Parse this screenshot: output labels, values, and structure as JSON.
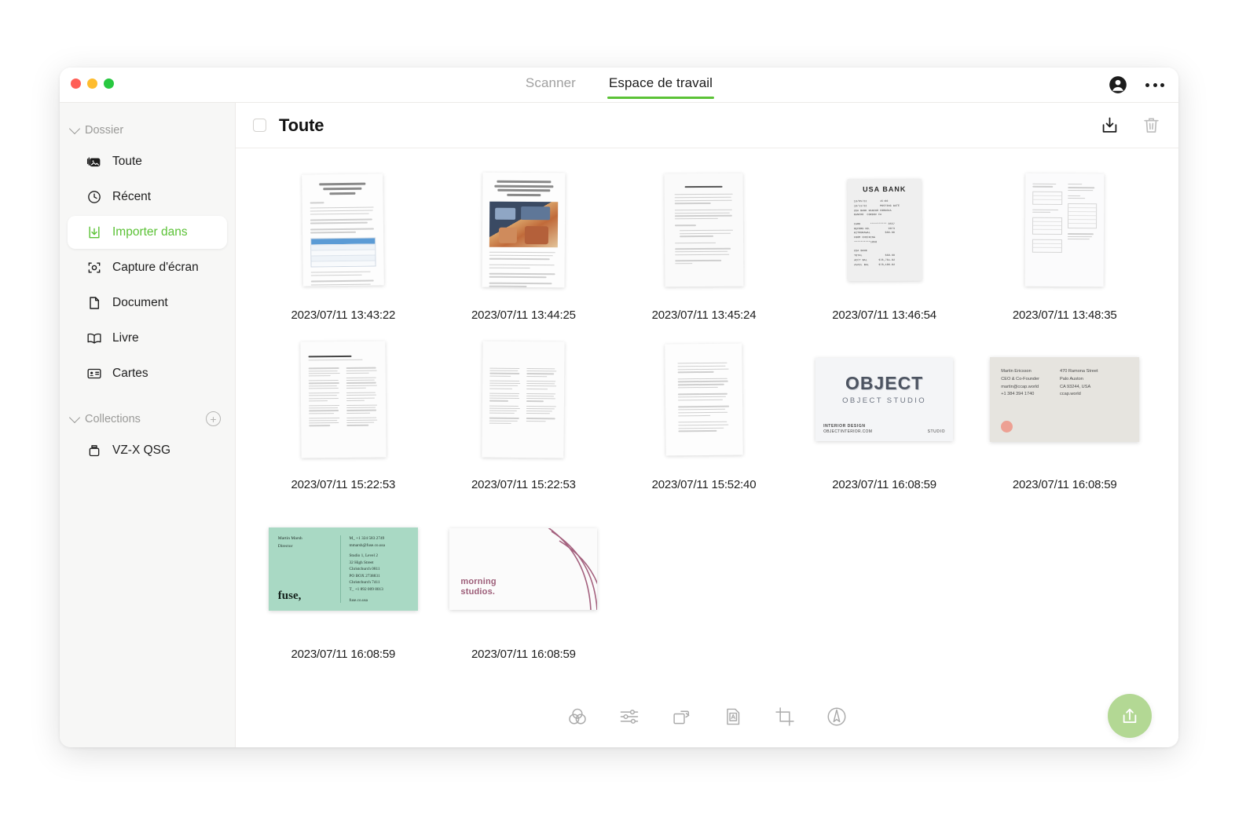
{
  "window": {
    "traffic_lights": [
      "close",
      "minimize",
      "zoom"
    ],
    "accent_color": "#5bc236",
    "fab_color": "#b3d894"
  },
  "header": {
    "tabs": [
      {
        "label": "Scanner",
        "active": false
      },
      {
        "label": "Espace de travail",
        "active": true
      }
    ],
    "account_icon": "account-circle-icon",
    "more_icon": "more-horizontal-icon"
  },
  "sidebar": {
    "groups": [
      {
        "label": "Dossier",
        "expanded": true,
        "items": [
          {
            "label": "Toute",
            "icon": "photos-stack-icon",
            "selected": false
          },
          {
            "label": "Récent",
            "icon": "clock-icon",
            "selected": false
          },
          {
            "label": "Importer dans",
            "icon": "import-download-icon",
            "selected": true
          },
          {
            "label": "Capture d'écran",
            "icon": "screenshot-icon",
            "selected": false
          },
          {
            "label": "Document",
            "icon": "document-icon",
            "selected": false
          },
          {
            "label": "Livre",
            "icon": "book-icon",
            "selected": false
          },
          {
            "label": "Cartes",
            "icon": "contact-card-icon",
            "selected": false
          }
        ]
      },
      {
        "label": "Collections",
        "expanded": true,
        "add_icon": "plus-circle-icon",
        "items": [
          {
            "label": "VZ-X QSG",
            "icon": "archive-box-icon",
            "selected": false
          }
        ]
      }
    ]
  },
  "main": {
    "title": "Toute",
    "select_all_checked": false,
    "actions": [
      {
        "name": "export-button",
        "icon": "download-tray-icon"
      },
      {
        "name": "delete-button",
        "icon": "trash-icon"
      }
    ],
    "items": [
      {
        "caption": "2023/07/11 13:43:22",
        "kind": "report-page",
        "title": "INTRODUCTION: HOW HAVE TECH STOCKS BEEN PERFORMING"
      },
      {
        "caption": "2023/07/11 13:44:25",
        "kind": "report-with-photo",
        "title": "GLOBAL INDUSTRY DEVELOPMENT AND COMPETITIVE LANDSCAPE FORECAST TO 2032"
      },
      {
        "caption": "2023/07/11 13:45:24",
        "kind": "contract-page",
        "title": "REAL ESTATE PURCHASE AGREEMENT"
      },
      {
        "caption": "2023/07/11 13:46:54",
        "kind": "bank-receipt",
        "title": "USA BANK"
      },
      {
        "caption": "2023/07/11 13:48:35",
        "kind": "table-page",
        "title": ""
      },
      {
        "caption": "2023/07/11 15:22:53",
        "kind": "article-spread",
        "title": "Why Sport Hasn't Changed in A Year?"
      },
      {
        "caption": "2023/07/11 15:22:53",
        "kind": "article-spread-2",
        "title": ""
      },
      {
        "caption": "2023/07/11 15:52:40",
        "kind": "text-page",
        "title": ""
      },
      {
        "caption": "2023/07/11 16:08:59",
        "kind": "object-card",
        "title": "OBJECT"
      },
      {
        "caption": "2023/07/11 16:08:59",
        "kind": "ccap-card",
        "title": "Martin Ericsson"
      },
      {
        "caption": "2023/07/11 16:08:59",
        "kind": "fuse-card",
        "title": "fuse,"
      },
      {
        "caption": "2023/07/11 16:08:59",
        "kind": "morning-card",
        "title": "morning studios."
      }
    ]
  },
  "cards": {
    "bank_receipt": {
      "header": "USA  BANK",
      "lines": [
        "10/05/22            15:00",
        "10/11/22            POSTING DATE",
        "USA BANK RANCHO CORDOVA",
        "RANCHO  CORDOV  CA",
        "CARD          ************ 0557",
        "RECORD NO.                 9973",
        "WITHDRAWAL               $60.00",
        "FROM CHECKING",
        "***********1858",
        "USA BANK",
        "TOTAL                    $60.00",
        "ACCT BAL             $78,761.82",
        "AVAIL BAL            $78,186.82"
      ]
    },
    "object_card": {
      "logo": "OBJECT",
      "sub": "OBJECT STUDIO",
      "footer_left": "INTERIOR    DESIGN",
      "footer_url": "OBJECTINTERIOR.COM",
      "footer_right": "STUDIO"
    },
    "ccap_card": {
      "left": [
        "Martin Ericsson",
        "CEO & Co-Founder",
        "martin@ccap.world",
        "+1 384 394 1740"
      ],
      "right": [
        "470 Ramona Street",
        "Palo Auston",
        "CA 93244, USA",
        "ccap.world"
      ]
    },
    "fuse_card": {
      "left": [
        "Martin Marsh",
        "Director"
      ],
      "right": [
        "M_ +1 324 583 2749",
        "mmarsh@fuse.co.usa",
        "",
        "Studio 1, Level 2",
        "32 High Street",
        "Christchurch 0811",
        "PO BOX 2738831",
        "Christchurch 7411",
        "T_ +1 892 009 8013"
      ],
      "logo": "fuse,",
      "url": "fuse.co.usa"
    },
    "morning_card": {
      "logo_line1": "morning",
      "logo_line2": "studios."
    },
    "report_page_1": {
      "title": "INTRODUCTION: HOW HAVE TECH STOCKS BEEN PERFORMING"
    },
    "report_page_2": {
      "title": "GLOBAL INDUSTRY DEVELOPMENT AND COMPETITIVE LANDSCAPE FORECAST TO 2032"
    },
    "contract_page": {
      "title": "REAL ESTATE PURCHASE AGREEMENT"
    },
    "article_page": {
      "title": "Why Sport Hasn't Changed in A Year?"
    }
  },
  "toolbar": {
    "tools": [
      {
        "name": "color-filter-tool",
        "icon": "color-circles-icon"
      },
      {
        "name": "adjust-tool",
        "icon": "sliders-icon"
      },
      {
        "name": "rotate-tool",
        "icon": "rotate-icon"
      },
      {
        "name": "ocr-tool",
        "icon": "text-recognition-icon"
      },
      {
        "name": "crop-tool",
        "icon": "crop-icon"
      },
      {
        "name": "annotate-tool",
        "icon": "pen-circle-icon"
      }
    ],
    "share_button": {
      "name": "share-button",
      "icon": "share-up-icon"
    }
  }
}
